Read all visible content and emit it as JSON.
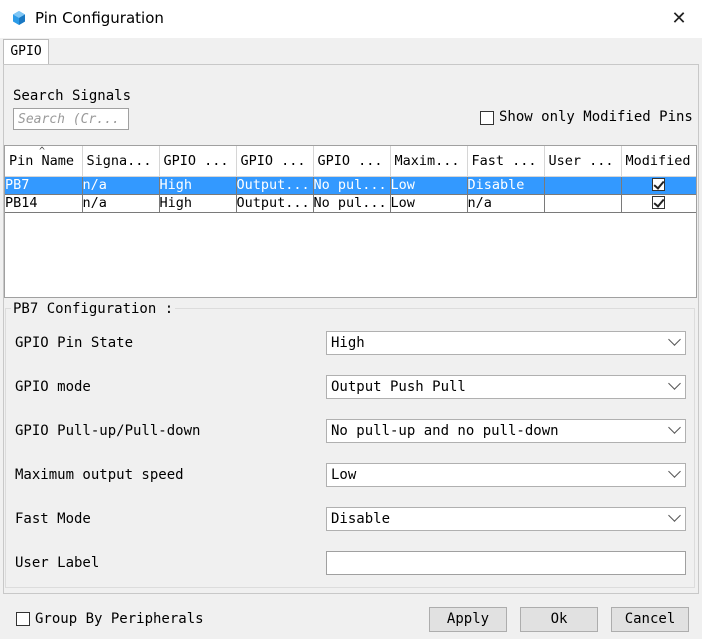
{
  "window": {
    "title": "Pin Configuration",
    "close_symbol": "✕"
  },
  "tabs": [
    {
      "label": "GPIO"
    }
  ],
  "search": {
    "label": "Search Signals",
    "placeholder": "Search (Cr..."
  },
  "filter": {
    "show_modified_label": "Show only Modified Pins",
    "show_modified_checked": false
  },
  "table": {
    "columns": [
      "Pin Name",
      "Signa...",
      "GPIO ...",
      "GPIO ...",
      "GPIO ...",
      "Maxim...",
      "Fast ...",
      "User ...",
      "Modified"
    ],
    "rows": [
      {
        "pin": "PB7",
        "signal": "n/a",
        "state": "High",
        "mode": "Output...",
        "pull": "No pul...",
        "speed": "Low",
        "fast": "Disable",
        "user": "",
        "modified": true,
        "selected": true
      },
      {
        "pin": "PB14",
        "signal": "n/a",
        "state": "High",
        "mode": "Output...",
        "pull": "No pul...",
        "speed": "Low",
        "fast": "n/a",
        "user": "",
        "modified": true,
        "selected": false
      }
    ]
  },
  "config": {
    "title": "PB7 Configuration :",
    "fields": [
      {
        "label": "GPIO Pin State",
        "value": "High"
      },
      {
        "label": "GPIO mode",
        "value": "Output Push Pull"
      },
      {
        "label": "GPIO Pull-up/Pull-down",
        "value": "No pull-up and no pull-down"
      },
      {
        "label": "Maximum output speed",
        "value": "Low"
      },
      {
        "label": "Fast Mode",
        "value": "Disable"
      },
      {
        "label": "User Label",
        "value": ""
      }
    ]
  },
  "footer": {
    "group_by_label": "Group By Peripherals",
    "apply": "Apply",
    "ok": "Ok",
    "cancel": "Cancel"
  }
}
